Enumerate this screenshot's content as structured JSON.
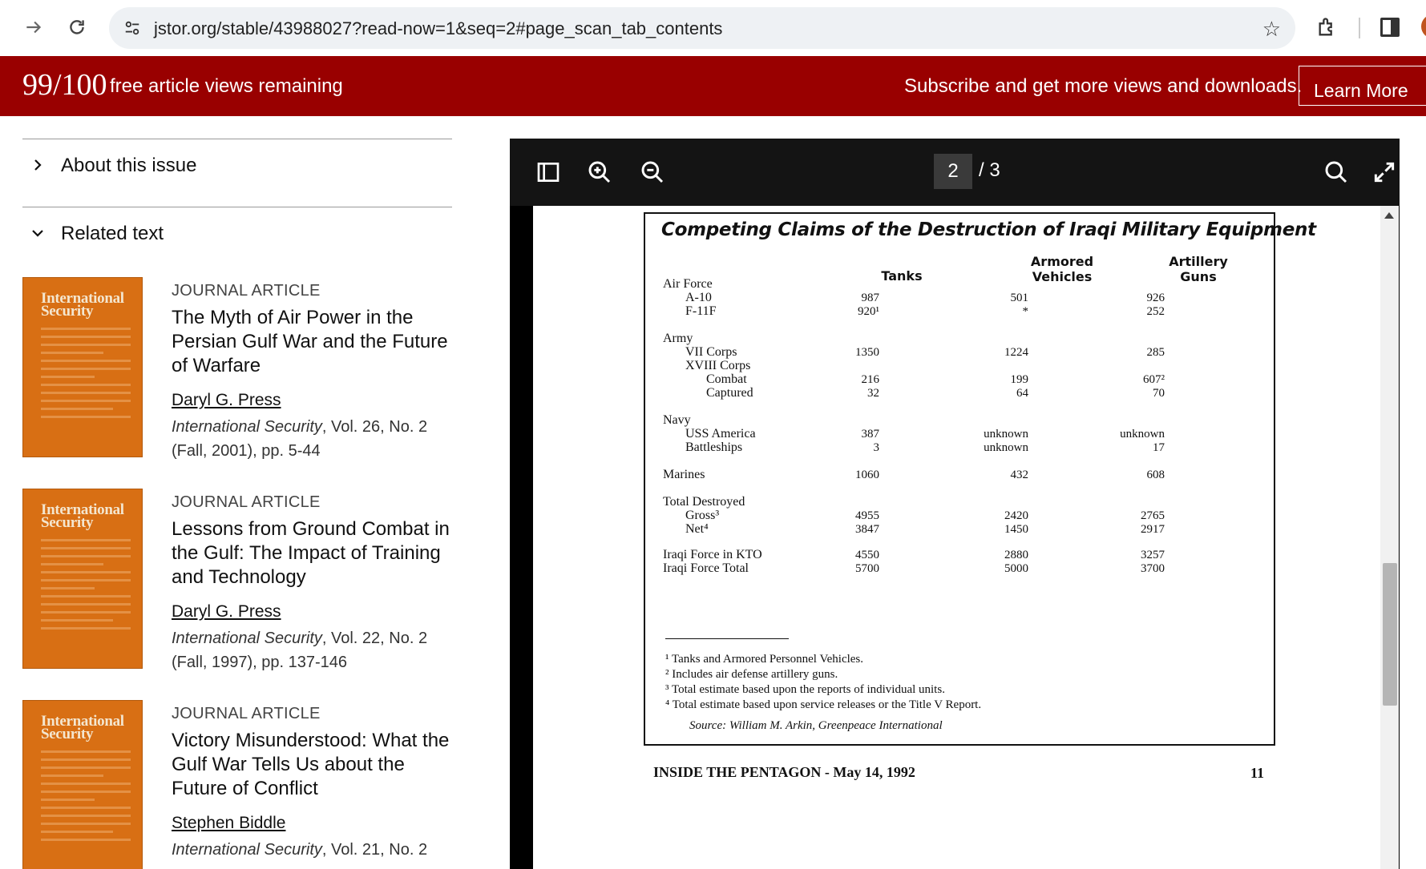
{
  "browser": {
    "url": "jstor.org/stable/43988027?read-now=1&seq=2#page_scan_tab_contents"
  },
  "banner": {
    "views_count": "99/100",
    "views_label": "free article views remaining",
    "subscribe_text": "Subscribe and get more views and downloads.",
    "learn_more": "Learn More"
  },
  "sidebar": {
    "about_issue": "About this issue",
    "related_text": "Related text",
    "articles": [
      {
        "type": "JOURNAL ARTICLE",
        "title": "The Myth of Air Power in the Persian Gulf War and the Future of Warfare",
        "author": "Daryl G. Press",
        "journal": "International Security",
        "cite": ", Vol. 26, No. 2 (Fall, 2001), pp. 5-44",
        "cover_title": "International Security"
      },
      {
        "type": "JOURNAL ARTICLE",
        "title": "Lessons from Ground Combat in the Gulf: The Impact of Training and Technology",
        "author": "Daryl G. Press",
        "journal": "International Security",
        "cite": ", Vol. 22, No. 2 (Fall, 1997), pp. 137-146",
        "cover_title": "International Security"
      },
      {
        "type": "JOURNAL ARTICLE",
        "title": "Victory Misunderstood: What the Gulf War Tells Us about the Future of Conflict",
        "author": "Stephen Biddle",
        "journal": "International Security",
        "cite": ", Vol. 21, No. 2",
        "cover_title": "International Security"
      }
    ]
  },
  "viewer": {
    "current_page": "2",
    "total_pages": "/ 3"
  },
  "document": {
    "title": "Competing Claims of the Destruction of Iraqi Military Equipment",
    "columns": {
      "tanks": "Tanks",
      "armored_1": "Armored",
      "armored_2": "Vehicles",
      "artillery_1": "Artillery",
      "artillery_2": "Guns"
    },
    "rows": [
      {
        "label": "Air Force",
        "indent": 0,
        "tanks": "",
        "armored": "",
        "artillery": ""
      },
      {
        "label": "A-10",
        "indent": 1,
        "tanks": "987",
        "armored": "501",
        "artillery": "926"
      },
      {
        "label": "F-11F",
        "indent": 1,
        "tanks": "920¹",
        "armored": "*",
        "artillery": "252"
      },
      {
        "label": "Army",
        "indent": 0,
        "tanks": "",
        "armored": "",
        "artillery": ""
      },
      {
        "label": "VII Corps",
        "indent": 1,
        "tanks": "1350",
        "armored": "1224",
        "artillery": "285"
      },
      {
        "label": "XVIII Corps",
        "indent": 1,
        "tanks": "",
        "armored": "",
        "artillery": ""
      },
      {
        "label": "Combat",
        "indent": 2,
        "tanks": "216",
        "armored": "199",
        "artillery": "607²"
      },
      {
        "label": "Captured",
        "indent": 2,
        "tanks": "32",
        "armored": "64",
        "artillery": "70"
      },
      {
        "label": "Navy",
        "indent": 0,
        "tanks": "",
        "armored": "",
        "artillery": ""
      },
      {
        "label": "USS America",
        "indent": 1,
        "tanks": "387",
        "armored": "unknown",
        "artillery": "unknown"
      },
      {
        "label": "Battleships",
        "indent": 1,
        "tanks": "3",
        "armored": "unknown",
        "artillery": "17"
      },
      {
        "label": "Marines",
        "indent": 0,
        "tanks": "1060",
        "armored": "432",
        "artillery": "608"
      },
      {
        "label": "Total Destroyed",
        "indent": 0,
        "tanks": "",
        "armored": "",
        "artillery": ""
      },
      {
        "label": "Gross³",
        "indent": 1,
        "tanks": "4955",
        "armored": "2420",
        "artillery": "2765"
      },
      {
        "label": "Net⁴",
        "indent": 1,
        "tanks": "3847",
        "armored": "1450",
        "artillery": "2917"
      },
      {
        "label": "Iraqi Force in KTO",
        "indent": 0,
        "tanks": "4550",
        "armored": "2880",
        "artillery": "3257"
      },
      {
        "label": "Iraqi Force Total",
        "indent": 0,
        "tanks": "5700",
        "armored": "5000",
        "artillery": "3700"
      }
    ],
    "footnotes": [
      "¹ Tanks and Armored Personnel Vehicles.",
      "² Includes air defense artillery guns.",
      "³ Total estimate based upon the reports of individual units.",
      "⁴ Total estimate based upon service releases or the Title V Report."
    ],
    "source": "Source: William M. Arkin, Greenpeace International",
    "footer_left": "INSIDE THE PENTAGON - May 14, 1992",
    "footer_right": "11"
  }
}
